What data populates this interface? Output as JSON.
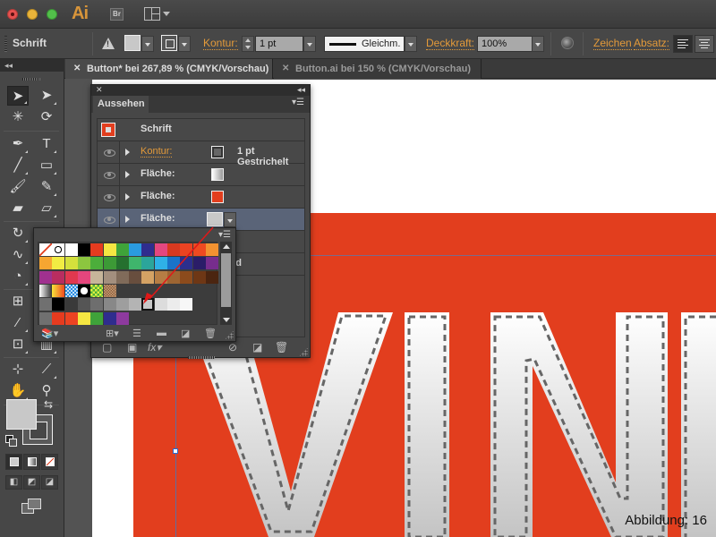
{
  "app": {
    "logo": "Ai",
    "bridge_label": "Br",
    "workspace_icon": "layout-icon"
  },
  "control_bar": {
    "object_type": "Schrift",
    "stroke_link": "Kontur:",
    "stroke_weight": "1 pt",
    "stroke_style": "Gleichm.",
    "opacity_link": "Deckkraft:",
    "opacity_value": "100%",
    "character_link": "Zeichen",
    "paragraph_link": "Absatz:",
    "fill_color": "#c8c8c8"
  },
  "tabs": [
    {
      "label": "Button* bei 267,89 % (CMYK/Vorschau)",
      "active": true
    },
    {
      "label": "Button.ai bei 150 % (CMYK/Vorschau)",
      "active": false
    }
  ],
  "appearance_panel": {
    "title": "Aussehen",
    "header_label": "Schrift",
    "rows": [
      {
        "label": "Kontur:",
        "is_link": true,
        "swatch": "stroke",
        "value": "1 pt Gestrichelt"
      },
      {
        "label": "Fläche:",
        "is_link": false,
        "swatch": "gradient",
        "value": ""
      },
      {
        "label": "Fläche:",
        "is_link": false,
        "swatch": "#e23e1e",
        "value": ""
      },
      {
        "label": "Fläche:",
        "is_link": false,
        "swatch": "#c8c8c8",
        "value": "",
        "selected": true
      }
    ],
    "hidden_row_fragment": "rd",
    "footer_icons": [
      "new-stroke-icon",
      "new-fill-icon",
      "fx-icon",
      "clear-icon",
      "duplicate-icon",
      "delete-icon"
    ],
    "fx_label": "fx"
  },
  "swatch_popup": {
    "rows": [
      [
        "none",
        "registration",
        "#ffffff",
        "#000000",
        "#e63b1f",
        "#f5e642",
        "#3fa33a",
        "#2a9be0",
        "#2f2d8e",
        "#e4477f",
        "#d8391f",
        "#ec4322",
        "#ef4a20",
        "#f39230"
      ],
      [
        "#f6a631",
        "#f1ec43",
        "#d4e03c",
        "#8cc63f",
        "#4cae3b",
        "#3c9a36",
        "#25702f",
        "#3fb56c",
        "#2ba59b",
        "#2fb1e7",
        "#1a73c9",
        "#2c2f8d",
        "#2b1d68",
        "#772d8d"
      ],
      [
        "#a0318f",
        "#b92d60",
        "#e0384f",
        "#e5467d",
        "#c6b59a",
        "#a38f7e",
        "#806b5a",
        "#684e3e",
        "#d4a264",
        "#b67d44",
        "#9d6532",
        "#8c4b1c",
        "#6e3715",
        "#4b2510"
      ],
      [
        "gradient-gray",
        "gradient-orange",
        "pattern-blue",
        "pattern-dots",
        "pattern-green",
        "pattern-brown"
      ],
      [
        "folder",
        "#000000",
        "#3a3a3a",
        "#555555",
        "#6e6e6e",
        "#888888",
        "#9e9e9e",
        "#b4b4b4",
        "#c8c8c8",
        "#dcdcdc",
        "#ececec",
        "#f7f7f7"
      ],
      [
        "folder",
        "#e63b1f",
        "#ec4322",
        "#f5e642",
        "#3fa33a",
        "#2f2d8e",
        "#8e3a9e"
      ]
    ],
    "selected_swatch": "#c8c8c8",
    "footer_icons": [
      "library-icon",
      "swatch-view-icon",
      "swatch-options-icon",
      "new-group-icon",
      "new-swatch-icon",
      "delete-icon"
    ]
  },
  "canvas": {
    "artboard_text": "VIN",
    "background_color": "#e23e1e",
    "letter_fill": "gradient-white-gray",
    "letter_stroke": "1 pt Gestrichelt"
  },
  "caption": "Abbildung: 16"
}
